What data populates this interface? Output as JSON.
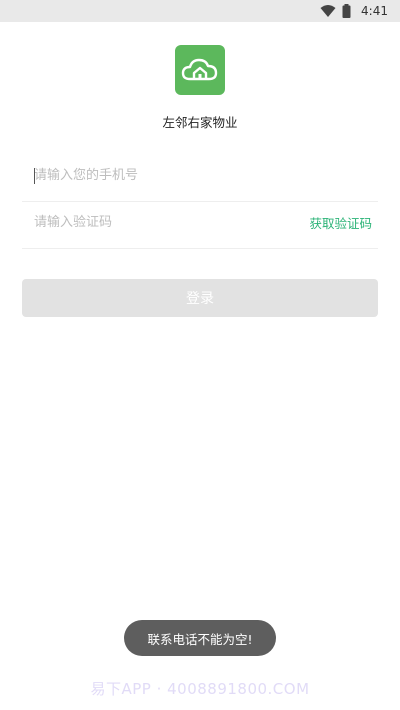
{
  "status_bar": {
    "time": "4:41",
    "wifi_icon": "wifi-icon",
    "battery_icon": "battery-icon"
  },
  "app": {
    "logo_icon": "cloud-house-icon",
    "name": "左邻右家物业",
    "brand_color": "#5cb85c"
  },
  "form": {
    "phone": {
      "placeholder": "请输入您的手机号",
      "value": ""
    },
    "code": {
      "placeholder": "请输入验证码",
      "value": ""
    },
    "get_code_label": "获取验证码",
    "get_code_color": "#2bb377",
    "login_label": "登录"
  },
  "toast": {
    "message": "联系电话不能为空!"
  },
  "watermark": {
    "text": "易下APP · 4008891800.COM"
  }
}
